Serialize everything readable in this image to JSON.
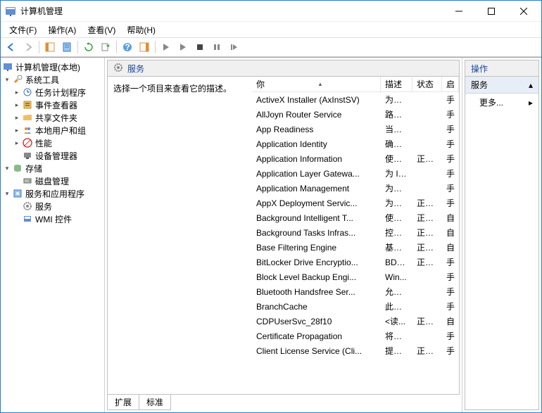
{
  "window": {
    "title": "计算机管理"
  },
  "menu": {
    "file": "文件(F)",
    "action": "操作(A)",
    "view": "查看(V)",
    "help": "帮助(H)"
  },
  "tree": {
    "root": "计算机管理(本地)",
    "sys_tools": "系统工具",
    "task_sched": "任务计划程序",
    "event_viewer": "事件查看器",
    "shared_folders": "共享文件夹",
    "local_users": "本地用户和组",
    "performance": "性能",
    "device_mgr": "设备管理器",
    "storage": "存储",
    "disk_mgmt": "磁盘管理",
    "services_apps": "服务和应用程序",
    "services": "服务",
    "wmi": "WMI 控件"
  },
  "center": {
    "hdr": "服务",
    "hint": "选择一个项目来查看它的描述。",
    "cols": {
      "name": "你",
      "desc": "描述",
      "state": "状态",
      "start": "启"
    },
    "tabs": {
      "ext": "扩展",
      "std": "标准"
    }
  },
  "services": [
    {
      "name": "ActiveX Installer (AxInstSV)",
      "desc": "为从 ...",
      "state": "",
      "start": "手"
    },
    {
      "name": "AllJoyn Router Service",
      "desc": "路由...",
      "state": "",
      "start": "手"
    },
    {
      "name": "App Readiness",
      "desc": "当用...",
      "state": "",
      "start": "手"
    },
    {
      "name": "Application Identity",
      "desc": "确定...",
      "state": "",
      "start": "手"
    },
    {
      "name": "Application Information",
      "desc": "使用...",
      "state": "正在...",
      "start": "手"
    },
    {
      "name": "Application Layer Gatewa...",
      "desc": "为 In...",
      "state": "",
      "start": "手"
    },
    {
      "name": "Application Management",
      "desc": "为通...",
      "state": "",
      "start": "手"
    },
    {
      "name": "AppX Deployment Servic...",
      "desc": "为部...",
      "state": "正在...",
      "start": "手"
    },
    {
      "name": "Background Intelligent T...",
      "desc": "使用...",
      "state": "正在...",
      "start": "自"
    },
    {
      "name": "Background Tasks Infras...",
      "desc": "控制...",
      "state": "正在...",
      "start": "自"
    },
    {
      "name": "Base Filtering Engine",
      "desc": "基本...",
      "state": "正在...",
      "start": "自"
    },
    {
      "name": "BitLocker Drive Encryptio...",
      "desc": "BDE...",
      "state": "正在...",
      "start": "手"
    },
    {
      "name": "Block Level Backup Engi...",
      "desc": "Win...",
      "state": "",
      "start": "手"
    },
    {
      "name": "Bluetooth Handsfree Ser...",
      "desc": "允许...",
      "state": "",
      "start": "手"
    },
    {
      "name": "BranchCache",
      "desc": "此服...",
      "state": "",
      "start": "手"
    },
    {
      "name": "CDPUserSvc_28f10",
      "desc": "<读...",
      "state": "正在...",
      "start": "自"
    },
    {
      "name": "Certificate Propagation",
      "desc": "将用...",
      "state": "",
      "start": "手"
    },
    {
      "name": "Client License Service (Cli...",
      "desc": "提供...",
      "state": "正在...",
      "start": "手"
    }
  ],
  "actions": {
    "hdr": "操作",
    "sub": "服务",
    "more": "更多..."
  }
}
